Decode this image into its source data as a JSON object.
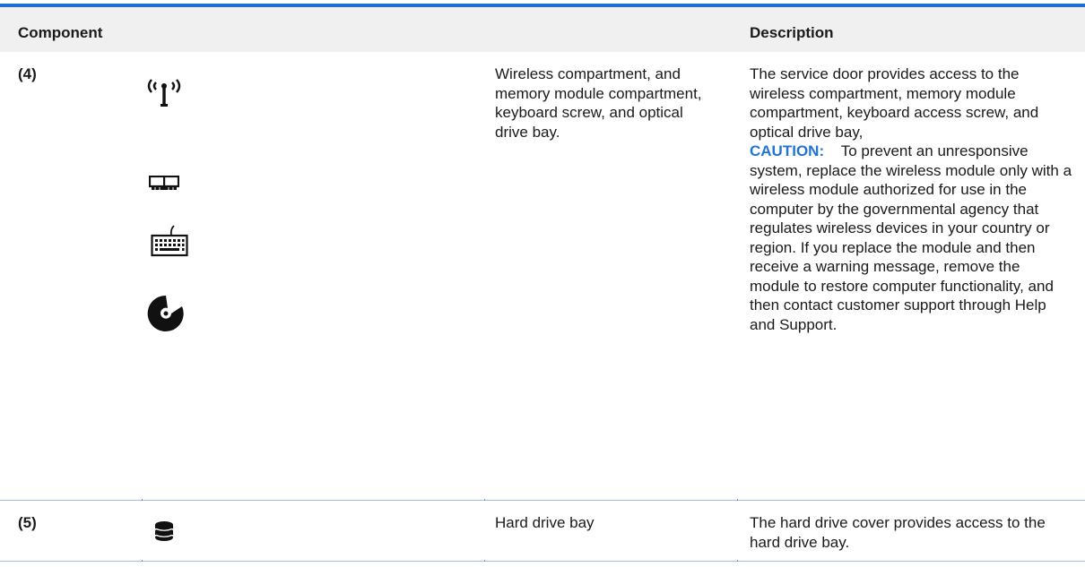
{
  "table": {
    "headers": {
      "component": "Component",
      "description": "Description"
    },
    "rows": [
      {
        "number": "(4)",
        "icons": [
          "wireless-icon",
          "memory-module-icon",
          "keyboard-icon",
          "optical-drive-icon"
        ],
        "component": "Wireless compartment, and memory module compartment, keyboard screw, and optical drive bay.",
        "description": "The service door provides access to the wireless compartment, memory module compartment, keyboard access screw, and optical drive bay,",
        "caution_label": "CAUTION:",
        "caution_text": "To prevent an unresponsive system, replace the wireless module only with a wireless module authorized for use in the computer by the governmental agency that regulates wireless devices in your country or region. If you replace the module and then receive a warning message, remove the module to restore computer functionality, and then contact customer support through Help and Support."
      },
      {
        "number": "(5)",
        "icons": [
          "hard-drive-icon"
        ],
        "component": "Hard drive bay",
        "description": "The hard drive cover provides access to the hard drive bay."
      }
    ]
  },
  "colors": {
    "accent": "#1f6fd1",
    "caution": "#1f74d6",
    "header_bg": "#f0f0f0"
  }
}
